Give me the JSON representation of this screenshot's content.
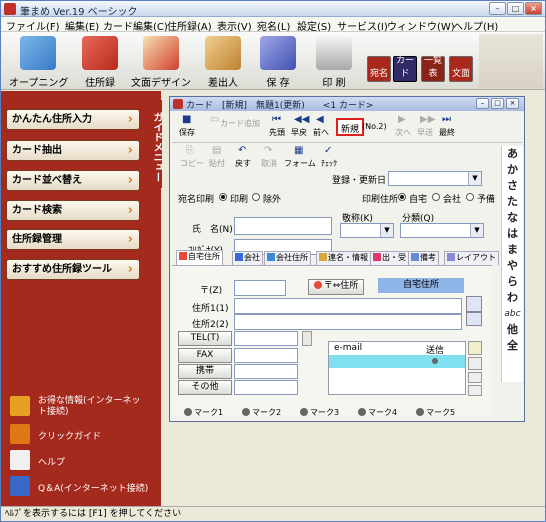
{
  "window": {
    "title": "筆まめ Ver.19 ベーシック",
    "min": "–",
    "max": "□",
    "close": "×"
  },
  "menubar": [
    "ファイル(F)",
    "編集(E)",
    "カード編集(C)",
    "住所録(A)",
    "表示(V)",
    "宛名(L)",
    "設定(S)",
    "サービス(I)",
    "ウィンドウ(W)",
    "ヘルプ(H)"
  ],
  "toolbar": {
    "opening": "オープニング",
    "address_book": "住所録",
    "design": "文面デザイン",
    "sender": "差出人",
    "save": "保 存",
    "print": "印 刷",
    "view_atena": "宛名",
    "view_card": "カード",
    "view_list": "一覧表",
    "view_bunmen": "文面"
  },
  "guide_tab": "ガイドメニュー",
  "left_menu": [
    "かんたん住所入力",
    "カード抽出",
    "カード並べ替え",
    "カード検索",
    "住所録管理",
    "おすすめ住所録ツール"
  ],
  "links": [
    {
      "icon": "info-icon",
      "text": "お得な情報(インターネット接続)"
    },
    {
      "icon": "question-icon",
      "text": "クリックガイド"
    },
    {
      "icon": "help-icon",
      "text": "ヘルプ"
    },
    {
      "icon": "qa-icon",
      "text": "Q＆A(インターネット接続)"
    }
  ],
  "card_window": {
    "title": "カード　[新規]　無題1(更新)　　<1 カード>",
    "toolbar1": {
      "save": "保存",
      "add_card": "カード追加",
      "first": "先頭",
      "prev_fast": "早戻",
      "prev": "前へ",
      "new": "新規",
      "counter": "(No.2)",
      "next": "次へ",
      "next_fast": "早送",
      "last": "最終"
    },
    "toolbar2": {
      "copy": "コピー",
      "paste": "貼付",
      "undo": "戻す",
      "cancel": "取消",
      "form": "フォーム",
      "check": "ﾁｪｯｸ"
    },
    "reg_date_label": "登録・更新日",
    "atena_print_label": "宛名印刷",
    "print_on": "印刷",
    "print_off": "除外",
    "print_address_label": "印刷住所",
    "addr_home": "自宅",
    "addr_company": "会社",
    "addr_spare": "予備",
    "name_label": "氏　名(N)",
    "furigana_label": "ﾌﾘｶﾞﾅ(Y)",
    "honorific_label": "敬称(K)",
    "category_label": "分類(Q)",
    "tabs": [
      "自宅住所",
      "会社",
      "会社住所",
      "連名・情報",
      "出・受",
      "備考",
      "レイアウト"
    ],
    "zip_label": "〒(Z)",
    "zip_convert": "〒⇔住所",
    "home_address_badge": "自宅住所",
    "address1_label": "住所1(1)",
    "address2_label": "住所2(2)",
    "tel_button": "TEL(T)",
    "fax_button": "FAX",
    "mobile_button": "携帯",
    "other_button": "その他",
    "email_header": "e-mail",
    "send_header": "送信",
    "marks": [
      "マーク1",
      "マーク2",
      "マーク3",
      "マーク4",
      "マーク5"
    ]
  },
  "kana_index": [
    "あ",
    "か",
    "さ",
    "た",
    "な",
    "は",
    "ま",
    "や",
    "ら",
    "わ",
    "abc",
    "他",
    "全"
  ],
  "statusbar": "ﾍﾙﾌﾟを表示するには [F1] を押してください",
  "colors": {
    "panel_red": "#a52a1e",
    "highlight_red": "#e02020",
    "email_row": "#7fe0f0"
  }
}
